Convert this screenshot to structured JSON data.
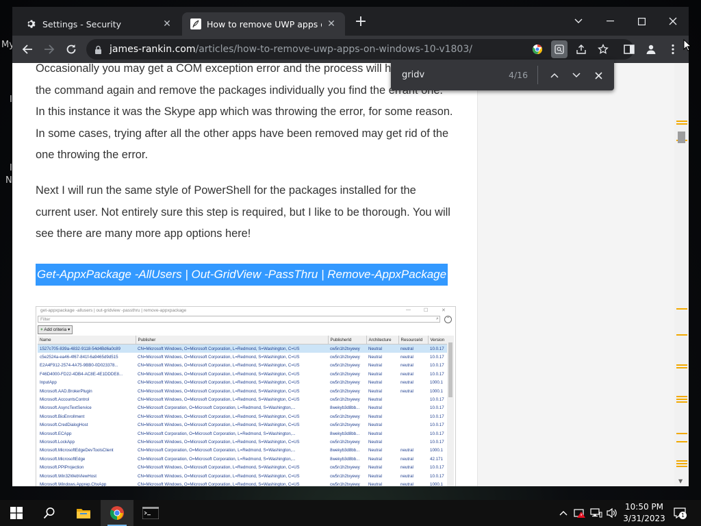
{
  "browser": {
    "tabs": [
      {
        "title": "Settings - Security",
        "icon": "gear-icon",
        "active": false
      },
      {
        "title": "How to remove UWP apps on Wi",
        "icon": "quill-icon",
        "active": true
      }
    ],
    "url_host": "james-rankin.com",
    "url_path": "/articles/how-to-remove-uwp-apps-on-windows-10-v1803/"
  },
  "desktop": {
    "edge_labels": [
      "My",
      "I",
      "I",
      "N"
    ]
  },
  "find": {
    "query": "gridv",
    "count": "4/16"
  },
  "article": {
    "paragraphs": [
      "Occasionally you may get a COM exception error and the process will happens, run the command again and remove the packages individually you find the errant one. In this instance it was the Skype app which was throwing the error, for some reason. In some cases, trying after all the other apps have been removed may get rid of the one throwing the error.",
      "Next I will run the same style of PowerShell for the packages installed for the current user. Not entirely sure this step is required, but I like to be thorough. You will see there are many more app options here!"
    ],
    "code": "Get-AppxPackage -AllUsers | Out-GridView -PassThru | Remove-AppxPackage"
  },
  "screenshot": {
    "title": "get-appxpackage -allusers | out-gridview -passthru | remove-appxpackage",
    "filter_placeholder": "Filter",
    "add_criteria": "Add criteria",
    "columns": [
      "Name",
      "Publisher",
      "PublisherId",
      "Architecture",
      "ResourceId",
      "Version"
    ],
    "rows": [
      [
        "1527c705-839a-4832-9118-54d4Bd6a0c89",
        "CN=Microsoft Windows, O=Microsoft Corporation, L=Redmond, S=Washington, C=US",
        "cw5n1h2txyewy",
        "Neutral",
        "neutral",
        "10.0.17"
      ],
      [
        "c5e2524a-ea46-4f67-841f-6a9465d9d515",
        "CN=Microsoft Windows, O=Microsoft Corporation, L=Redmond, S=Washington, C=US",
        "cw5n1h2txyewy",
        "Neutral",
        "neutral",
        "10.0.17"
      ],
      [
        "E2A4F912-2574-4A75-9BB0-0D023378...",
        "CN=Microsoft Windows, O=Microsoft Corporation, L=Redmond, S=Washington, C=US",
        "cw5n1h2txyewy",
        "Neutral",
        "neutral",
        "10.0.17"
      ],
      [
        "F46D4000-FD22-4DB4-AC8E-4E1DDDE8...",
        "CN=Microsoft Windows, O=Microsoft Corporation, L=Redmond, S=Washington, C=US",
        "cw5n1h2txyewy",
        "Neutral",
        "neutral",
        "10.0.17"
      ],
      [
        "InputApp",
        "CN=Microsoft Windows, O=Microsoft Corporation, L=Redmond, S=Washington, C=US",
        "cw5n1h2txyewy",
        "Neutral",
        "neutral",
        "1000.1"
      ],
      [
        "Microsoft.AAD.BrokerPlugin",
        "CN=Microsoft Windows, O=Microsoft Corporation, L=Redmond, S=Washington, C=US",
        "cw5n1h2txyewy",
        "Neutral",
        "neutral",
        "1000.1"
      ],
      [
        "Microsoft.AccountsControl",
        "CN=Microsoft Windows, O=Microsoft Corporation, L=Redmond, S=Washington, C=US",
        "cw5n1h2txyewy",
        "Neutral",
        "",
        "10.0.17"
      ],
      [
        "Microsoft.AsyncTextService",
        "CN=Microsoft Corporation, O=Microsoft Corporation, L=Redmond, S=Washington,...",
        "8wekyb3d8bb...",
        "Neutral",
        "",
        "10.0.17"
      ],
      [
        "Microsoft.BioEnrollment",
        "CN=Microsoft Windows, O=Microsoft Corporation, L=Redmond, S=Washington, C=US",
        "cw5n1h2txyewy",
        "Neutral",
        "",
        "10.0.17"
      ],
      [
        "Microsoft.CredDialogHost",
        "CN=Microsoft Windows, O=Microsoft Corporation, L=Redmond, S=Washington, C=US",
        "cw5n1h2txyewy",
        "Neutral",
        "",
        "10.0.17"
      ],
      [
        "Microsoft.ECApp",
        "CN=Microsoft Corporation, O=Microsoft Corporation, L=Redmond, S=Washington,...",
        "8wekyb3d8bb...",
        "Neutral",
        "",
        "10.0.17"
      ],
      [
        "Microsoft.LockApp",
        "CN=Microsoft Windows, O=Microsoft Corporation, L=Redmond, S=Washington, C=US",
        "cw5n1h2txyewy",
        "Neutral",
        "",
        "10.0.17"
      ],
      [
        "Microsoft.MicrosoftEdgeDevToolsClient",
        "CN=Microsoft Corporation, O=Microsoft Corporation, L=Redmond, S=Washington,...",
        "8wekyb3d8bb...",
        "Neutral",
        "neutral",
        "1000.1"
      ],
      [
        "Microsoft.MicrosoftEdge",
        "CN=Microsoft Corporation, O=Microsoft Corporation, L=Redmond, S=Washington,...",
        "8wekyb3d8bb...",
        "Neutral",
        "neutral",
        "42.171"
      ],
      [
        "Microsoft.PPIProjection",
        "CN=Microsoft Windows, O=Microsoft Corporation, L=Redmond, S=Washington, C=US",
        "cw5n1h2txyewy",
        "Neutral",
        "neutral",
        "10.0.17"
      ],
      [
        "Microsoft.Win32WebViewHost",
        "CN=Microsoft Windows, O=Microsoft Corporation, L=Redmond, S=Washington, C=US",
        "cw5n1h2txyewy",
        "Neutral",
        "neutral",
        "10.0.17"
      ],
      [
        "Microsoft.Windows.Apprep.ChxApp",
        "CN=Microsoft Windows, O=Microsoft Corporation, L=Redmond, S=Washington, C=US",
        "cw5n1h2txyewy",
        "Neutral",
        "neutral",
        "1000.1"
      ]
    ]
  },
  "taskbar": {
    "apps": [
      "file-explorer-icon",
      "chrome-icon",
      "terminal-icon"
    ],
    "time": "10:50 PM",
    "date": "3/31/2023",
    "notification_count": "1"
  },
  "colors": {
    "highlight": "#3399ff",
    "find_marker": "#f2a900",
    "chrome_dark": "#202124",
    "chrome_toolbar": "#35363a"
  }
}
